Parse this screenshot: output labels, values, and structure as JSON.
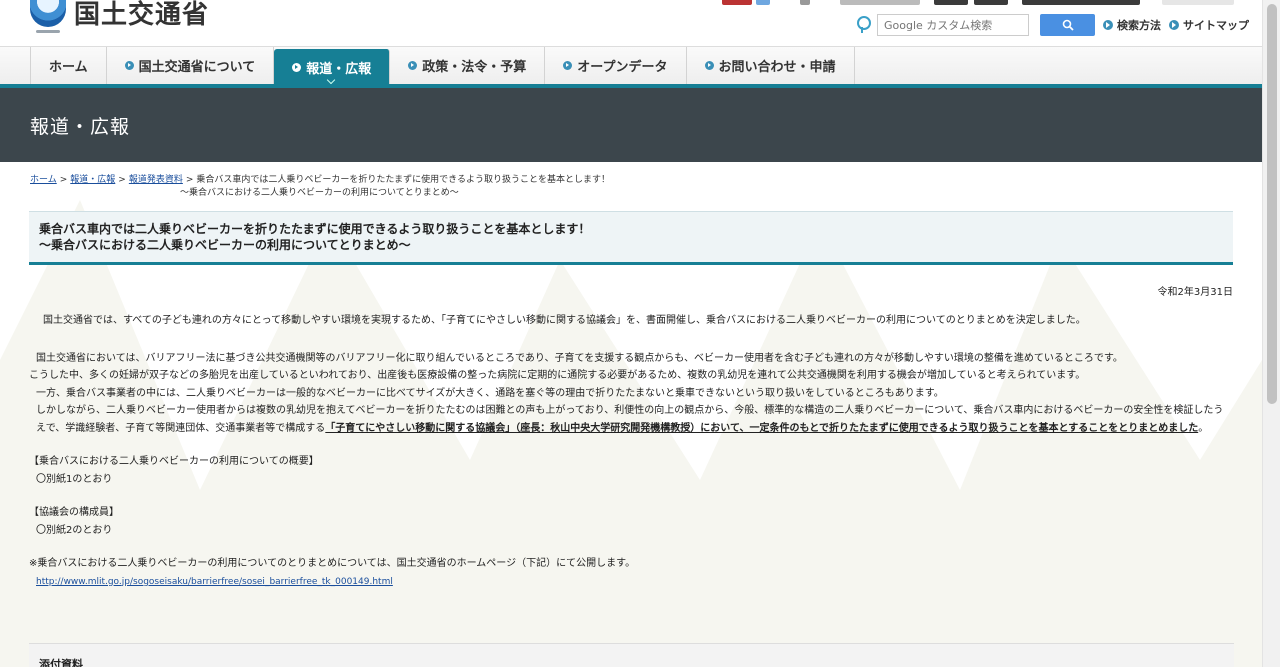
{
  "header": {
    "logo_text": "国土交通省",
    "search": {
      "placeholder": "Google カスタム検索"
    },
    "links": [
      "検索方法",
      "サイトマップ"
    ]
  },
  "nav": {
    "items": [
      {
        "label": "ホーム",
        "bullet": false,
        "active": false
      },
      {
        "label": "国土交通省について",
        "bullet": true,
        "active": false
      },
      {
        "label": "報道・広報",
        "bullet": true,
        "active": true
      },
      {
        "label": "政策・法令・予算",
        "bullet": true,
        "active": false
      },
      {
        "label": "オープンデータ",
        "bullet": true,
        "active": false
      },
      {
        "label": "お問い合わせ・申請",
        "bullet": true,
        "active": false
      }
    ]
  },
  "banner": {
    "title": "報道・広報"
  },
  "breadcrumb": {
    "home": "ホーム",
    "press": "報道・広報",
    "releases": "報道発表資料",
    "current_line1": "乗合バス車内では二人乗りベビーカーを折りたたまずに使用できるよう取り扱うことを基本とします！",
    "current_line2": "～乗合バスにおける二人乗りベビーカーの利用についてとりまとめ～"
  },
  "article": {
    "title_line1": "乗合バス車内では二人乗りベビーカーを折りたたまずに使用できるよう取り扱うことを基本とします！",
    "title_line2": "～乗合バスにおける二人乗りベビーカーの利用についてとりまとめ～",
    "date": "令和2年3月31日",
    "lead": "国土交通省では、すべての子ども連れの方々にとって移動しやすい環境を実現するため、「子育てにやさしい移動に関する協議会」を、書面開催し、乗合バスにおける二人乗りベビーカーの利用についてのとりまとめを決定しました。",
    "p1": "国土交通省においては、バリアフリー法に基づき公共交通機関等のバリアフリー化に取り組んでいるところであり、子育てを支援する観点からも、ベビーカー使用者を含む子ども連れの方々が移動しやすい環境の整備を進めているところです。",
    "p2": "こうした中、多くの妊婦が双子などの多胎児を出産しているといわれており、出産後も医療設備の整った病院に定期的に通院する必要があるため、複数の乳幼児を連れて公共交通機関を利用する機会が増加していると考えられています。",
    "p3": "一方、乗合バス事業者の中には、二人乗りベビーカーは一般的なベビーカーに比べてサイズが大きく、通路を塞ぐ等の理由で折りたたまないと乗車できないという取り扱いをしているところもあります。",
    "p4a": "しかしながら、二人乗りベビーカー使用者からは複数の乳幼児を抱えてベビーカーを折りたたむのは困難との声も上がっており、利便性の向上の観点から、今般、標準的な構造の二人乗りベビーカーについて、乗合バス車内におけるベビーカーの安全性を検証したうえで、学識経験者、子育て等関連団体、交通事業者等で構成する",
    "p4_link": "「子育てにやさしい移動に関する協議会」（座長：秋山中央大学研究開発機構教授）において、一定条件のもとで折りたたまずに使用できるよう取り扱うことを基本とすることをとりまとめました",
    "p4b": "。",
    "overview_heading": "【乗合バスにおける二人乗りベビーカーの利用についての概要】",
    "overview_item": "〇別紙1のとおり",
    "members_heading": "【協議会の構成員】",
    "members_item": "〇別紙2のとおり",
    "note": "※乗合バスにおける二人乗りベビーカーの利用についてのとりまとめについては、国土交通省のホームページ（下記）にて公開します。",
    "url": "http://www.mlit.go.jp/sogoseisaku/barrierfree/sosei_barrierfree_tk_000149.html",
    "attachments_heading": "添付資料"
  },
  "colors": {
    "accent": "#167f95",
    "banner": "#3c464c",
    "link": "#1a4e9c",
    "search_button": "#4a90e2"
  }
}
